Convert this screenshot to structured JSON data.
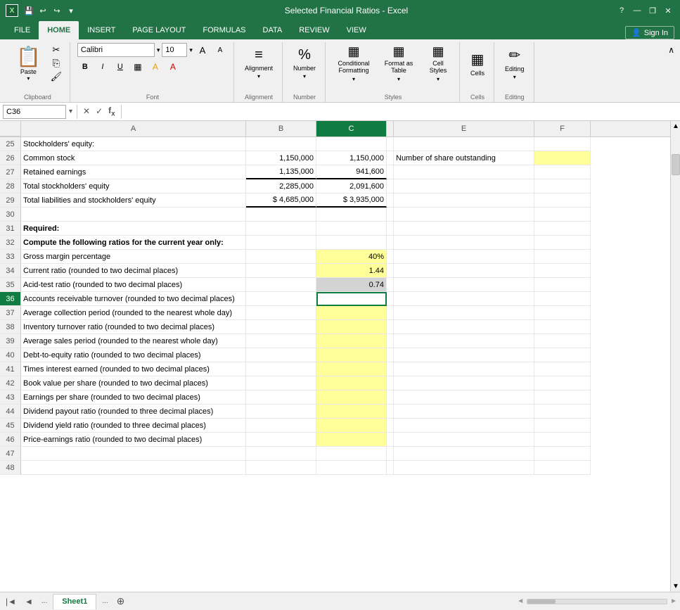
{
  "titlebar": {
    "title": "Selected Financial Ratios - Excel",
    "help_btn": "?",
    "minimize_btn": "—",
    "restore_btn": "❐",
    "close_btn": "✕"
  },
  "quickaccess": {
    "save_label": "💾",
    "undo_label": "↩",
    "redo_label": "↪",
    "customize_label": "▾"
  },
  "ribbon_tabs": [
    "FILE",
    "HOME",
    "INSERT",
    "PAGE LAYOUT",
    "FORMULAS",
    "DATA",
    "REVIEW",
    "VIEW"
  ],
  "active_tab": "HOME",
  "sign_in": "Sign In",
  "ribbon": {
    "clipboard_label": "Clipboard",
    "font_label": "Font",
    "alignment_label": "Alignment",
    "number_label": "Number",
    "styles_label": "Styles",
    "cells_label": "Cells",
    "editing_label": "Editing",
    "paste_label": "Paste",
    "cut_label": "✂",
    "copy_label": "⎘",
    "format_painter_label": "🖌",
    "font_name": "Calibri",
    "font_size": "10",
    "bold_label": "B",
    "italic_label": "I",
    "underline_label": "U",
    "alignment_icon": "≡",
    "number_icon": "%",
    "conditional_formatting_label": "Conditional\nFormatting",
    "format_table_label": "Format as\nTable",
    "cell_styles_label": "Cell\nStyles",
    "cells_icon": "▦",
    "editing_icon": "✏"
  },
  "formula_bar": {
    "cell_ref": "C36",
    "formula": ""
  },
  "columns": [
    "A",
    "B",
    "C",
    "E",
    "F"
  ],
  "col_headers_display": [
    "",
    "A",
    "B",
    "C",
    "E",
    "F"
  ],
  "rows": [
    {
      "num": "25",
      "cells": [
        {
          "col": "a",
          "text": "Stockholders' equity:",
          "align": "left",
          "style": ""
        },
        {
          "col": "b",
          "text": "",
          "align": "right"
        },
        {
          "col": "c",
          "text": "",
          "align": "right"
        },
        {
          "col": "e",
          "text": "",
          "align": "left"
        },
        {
          "col": "f",
          "text": "",
          "align": "left"
        }
      ]
    },
    {
      "num": "26",
      "cells": [
        {
          "col": "a",
          "text": "   Common stock",
          "align": "left",
          "style": ""
        },
        {
          "col": "b",
          "text": "1,150,000",
          "align": "right"
        },
        {
          "col": "c",
          "text": "1,150,000",
          "align": "right"
        },
        {
          "col": "e",
          "text": "Number of share outstanding",
          "align": "left"
        },
        {
          "col": "f",
          "text": "",
          "align": "left",
          "bg": "yellow"
        }
      ]
    },
    {
      "num": "27",
      "cells": [
        {
          "col": "a",
          "text": "   Retained earnings",
          "align": "left",
          "style": ""
        },
        {
          "col": "b",
          "text": "1,135,000",
          "align": "right",
          "underline": true
        },
        {
          "col": "c",
          "text": "941,600",
          "align": "right",
          "underline": true
        },
        {
          "col": "e",
          "text": "",
          "align": "left"
        },
        {
          "col": "f",
          "text": "",
          "align": "left"
        }
      ]
    },
    {
      "num": "28",
      "cells": [
        {
          "col": "a",
          "text": "Total stockholders' equity",
          "align": "left"
        },
        {
          "col": "b",
          "text": "2,285,000",
          "align": "right"
        },
        {
          "col": "c",
          "text": "2,091,600",
          "align": "right"
        },
        {
          "col": "e",
          "text": "",
          "align": "left"
        },
        {
          "col": "f",
          "text": "",
          "align": "left"
        }
      ]
    },
    {
      "num": "29",
      "cells": [
        {
          "col": "a",
          "text": "Total liabilities and stockholders' equity",
          "align": "left"
        },
        {
          "col": "b",
          "text": "$    4,685,000",
          "align": "right",
          "underline": true
        },
        {
          "col": "c",
          "text": "$  3,935,000",
          "align": "right",
          "underline": true
        },
        {
          "col": "e",
          "text": "",
          "align": "left"
        },
        {
          "col": "f",
          "text": "",
          "align": "left"
        }
      ]
    },
    {
      "num": "30",
      "cells": [
        {
          "col": "a",
          "text": "",
          "align": "left"
        },
        {
          "col": "b",
          "text": "",
          "align": "right"
        },
        {
          "col": "c",
          "text": "",
          "align": "right"
        },
        {
          "col": "e",
          "text": "",
          "align": "left"
        },
        {
          "col": "f",
          "text": "",
          "align": "left"
        }
      ]
    },
    {
      "num": "31",
      "cells": [
        {
          "col": "a",
          "text": "Required:",
          "align": "left",
          "bold": true
        },
        {
          "col": "b",
          "text": "",
          "align": "right"
        },
        {
          "col": "c",
          "text": "",
          "align": "right"
        },
        {
          "col": "e",
          "text": "",
          "align": "left"
        },
        {
          "col": "f",
          "text": "",
          "align": "left"
        }
      ]
    },
    {
      "num": "32",
      "cells": [
        {
          "col": "a",
          "text": "Compute the following ratios for the current year only:",
          "align": "left",
          "bold": true
        },
        {
          "col": "b",
          "text": "",
          "align": "right"
        },
        {
          "col": "c",
          "text": "",
          "align": "right"
        },
        {
          "col": "e",
          "text": "",
          "align": "left"
        },
        {
          "col": "f",
          "text": "",
          "align": "left"
        }
      ]
    },
    {
      "num": "33",
      "cells": [
        {
          "col": "a",
          "text": "Gross margin percentage",
          "align": "left"
        },
        {
          "col": "b",
          "text": "",
          "align": "right"
        },
        {
          "col": "c",
          "text": "40%",
          "align": "right",
          "bg": "yellow"
        },
        {
          "col": "e",
          "text": "",
          "align": "left"
        },
        {
          "col": "f",
          "text": "",
          "align": "left"
        }
      ]
    },
    {
      "num": "34",
      "cells": [
        {
          "col": "a",
          "text": "Current ratio (rounded to two decimal places)",
          "align": "left"
        },
        {
          "col": "b",
          "text": "",
          "align": "right"
        },
        {
          "col": "c",
          "text": "1.44",
          "align": "right",
          "bg": "yellow"
        },
        {
          "col": "e",
          "text": "",
          "align": "left"
        },
        {
          "col": "f",
          "text": "",
          "align": "left"
        }
      ]
    },
    {
      "num": "35",
      "cells": [
        {
          "col": "a",
          "text": "Acid-test ratio (rounded to two decimal places)",
          "align": "left"
        },
        {
          "col": "b",
          "text": "",
          "align": "right"
        },
        {
          "col": "c",
          "text": "0.74",
          "align": "right",
          "bg": "gray"
        },
        {
          "col": "e",
          "text": "",
          "align": "left"
        },
        {
          "col": "f",
          "text": "",
          "align": "left"
        }
      ]
    },
    {
      "num": "36",
      "cells": [
        {
          "col": "a",
          "text": "Accounts receivable turnover (rounded to two decimal places)",
          "align": "left"
        },
        {
          "col": "b",
          "text": "",
          "align": "right"
        },
        {
          "col": "c",
          "text": "",
          "align": "right",
          "active": true
        },
        {
          "col": "e",
          "text": "",
          "align": "left"
        },
        {
          "col": "f",
          "text": "",
          "align": "left"
        }
      ]
    },
    {
      "num": "37",
      "cells": [
        {
          "col": "a",
          "text": "Average collection period (rounded to the nearest whole day)",
          "align": "left"
        },
        {
          "col": "b",
          "text": "",
          "align": "right"
        },
        {
          "col": "c",
          "text": "",
          "align": "right",
          "bg": "yellow"
        },
        {
          "col": "e",
          "text": "",
          "align": "left"
        },
        {
          "col": "f",
          "text": "",
          "align": "left"
        }
      ]
    },
    {
      "num": "38",
      "cells": [
        {
          "col": "a",
          "text": "Inventory turnover ratio (rounded to two decimal places)",
          "align": "left"
        },
        {
          "col": "b",
          "text": "",
          "align": "right"
        },
        {
          "col": "c",
          "text": "",
          "align": "right",
          "bg": "yellow"
        },
        {
          "col": "e",
          "text": "",
          "align": "left"
        },
        {
          "col": "f",
          "text": "",
          "align": "left"
        }
      ]
    },
    {
      "num": "39",
      "cells": [
        {
          "col": "a",
          "text": "Average sales period (rounded to the nearest whole day)",
          "align": "left"
        },
        {
          "col": "b",
          "text": "",
          "align": "right"
        },
        {
          "col": "c",
          "text": "",
          "align": "right",
          "bg": "yellow"
        },
        {
          "col": "e",
          "text": "",
          "align": "left"
        },
        {
          "col": "f",
          "text": "",
          "align": "left"
        }
      ]
    },
    {
      "num": "40",
      "cells": [
        {
          "col": "a",
          "text": "Debt-to-equity ratio (rounded to two decimal places)",
          "align": "left"
        },
        {
          "col": "b",
          "text": "",
          "align": "right"
        },
        {
          "col": "c",
          "text": "",
          "align": "right",
          "bg": "yellow"
        },
        {
          "col": "e",
          "text": "",
          "align": "left"
        },
        {
          "col": "f",
          "text": "",
          "align": "left"
        }
      ]
    },
    {
      "num": "41",
      "cells": [
        {
          "col": "a",
          "text": "Times interest earned (rounded to two decimal places)",
          "align": "left"
        },
        {
          "col": "b",
          "text": "",
          "align": "right"
        },
        {
          "col": "c",
          "text": "",
          "align": "right",
          "bg": "yellow"
        },
        {
          "col": "e",
          "text": "",
          "align": "left"
        },
        {
          "col": "f",
          "text": "",
          "align": "left"
        }
      ]
    },
    {
      "num": "42",
      "cells": [
        {
          "col": "a",
          "text": "Book value per share (rounded to two decimal places)",
          "align": "left"
        },
        {
          "col": "b",
          "text": "",
          "align": "right"
        },
        {
          "col": "c",
          "text": "",
          "align": "right",
          "bg": "yellow"
        },
        {
          "col": "e",
          "text": "",
          "align": "left"
        },
        {
          "col": "f",
          "text": "",
          "align": "left"
        }
      ]
    },
    {
      "num": "43",
      "cells": [
        {
          "col": "a",
          "text": "Earnings per share (rounded to two decimal places)",
          "align": "left"
        },
        {
          "col": "b",
          "text": "",
          "align": "right"
        },
        {
          "col": "c",
          "text": "",
          "align": "right",
          "bg": "yellow"
        },
        {
          "col": "e",
          "text": "",
          "align": "left"
        },
        {
          "col": "f",
          "text": "",
          "align": "left"
        }
      ]
    },
    {
      "num": "44",
      "cells": [
        {
          "col": "a",
          "text": "Dividend payout ratio (rounded to three decimal places)",
          "align": "left"
        },
        {
          "col": "b",
          "text": "",
          "align": "right"
        },
        {
          "col": "c",
          "text": "",
          "align": "right",
          "bg": "yellow"
        },
        {
          "col": "e",
          "text": "",
          "align": "left"
        },
        {
          "col": "f",
          "text": "",
          "align": "left"
        }
      ]
    },
    {
      "num": "45",
      "cells": [
        {
          "col": "a",
          "text": "Dividend yield ratio (rounded to three decimal places)",
          "align": "left"
        },
        {
          "col": "b",
          "text": "",
          "align": "right"
        },
        {
          "col": "c",
          "text": "",
          "align": "right",
          "bg": "yellow"
        },
        {
          "col": "e",
          "text": "",
          "align": "left"
        },
        {
          "col": "f",
          "text": "",
          "align": "left"
        }
      ]
    },
    {
      "num": "46",
      "cells": [
        {
          "col": "a",
          "text": "Price-earnings ratio (rounded to two decimal places)",
          "align": "left"
        },
        {
          "col": "b",
          "text": "",
          "align": "right"
        },
        {
          "col": "c",
          "text": "",
          "align": "right",
          "bg": "yellow"
        },
        {
          "col": "e",
          "text": "",
          "align": "left"
        },
        {
          "col": "f",
          "text": "",
          "align": "left"
        }
      ]
    },
    {
      "num": "47",
      "cells": [
        {
          "col": "a",
          "text": "",
          "align": "left"
        },
        {
          "col": "b",
          "text": "",
          "align": "right"
        },
        {
          "col": "c",
          "text": "",
          "align": "right"
        },
        {
          "col": "e",
          "text": "",
          "align": "left"
        },
        {
          "col": "f",
          "text": "",
          "align": "left"
        }
      ]
    },
    {
      "num": "48",
      "cells": [
        {
          "col": "a",
          "text": "",
          "align": "left"
        },
        {
          "col": "b",
          "text": "",
          "align": "right"
        },
        {
          "col": "c",
          "text": "",
          "align": "right"
        },
        {
          "col": "e",
          "text": "",
          "align": "left"
        },
        {
          "col": "f",
          "text": "",
          "align": "left"
        }
      ]
    }
  ],
  "sheet_tabs": [
    "...",
    "Sheet1",
    "..."
  ],
  "active_sheet": "Sheet1",
  "colors": {
    "excel_green": "#217346",
    "active_cell_border": "#107c41",
    "yellow_fill": "#ffff99",
    "gray_fill": "#c8c8c8",
    "col_c_header_bg": "#bdd7ee"
  }
}
